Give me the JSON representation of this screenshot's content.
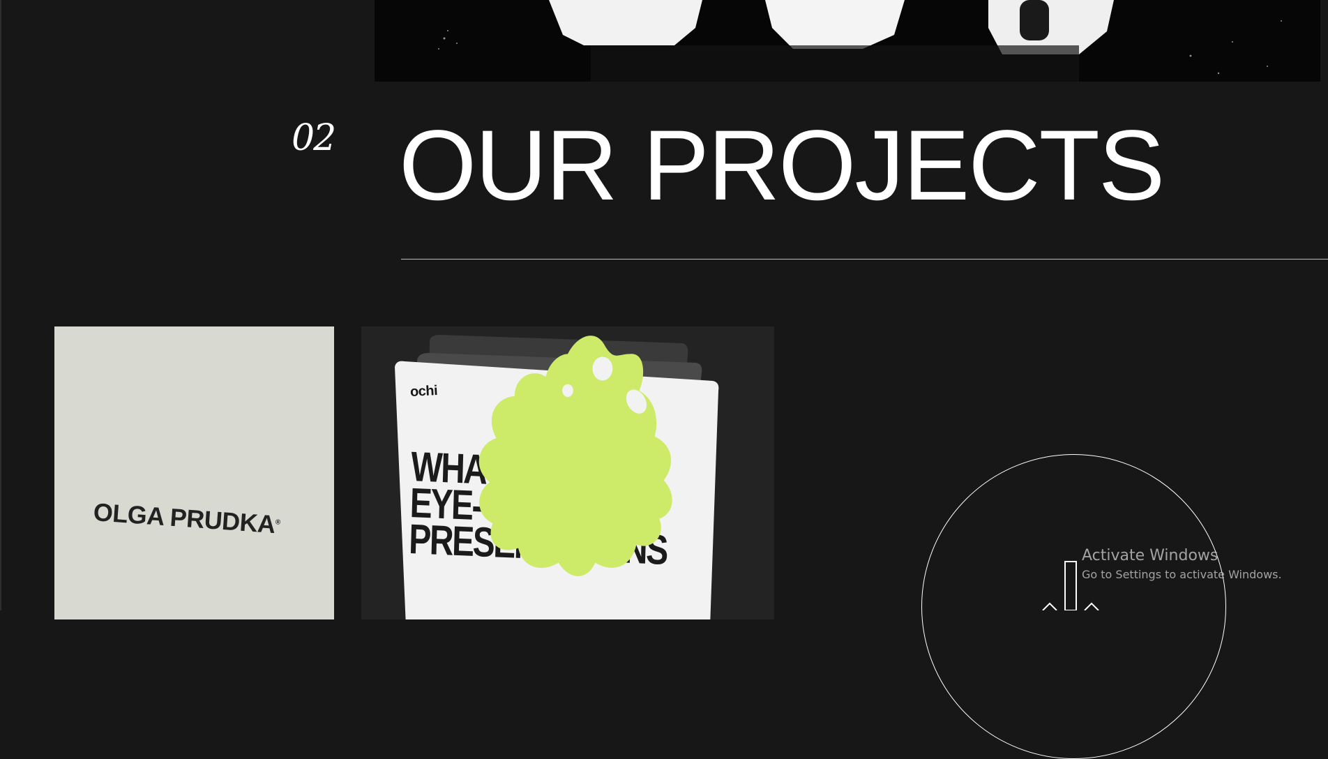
{
  "section": {
    "number": "02",
    "title": "OUR PROJECTS"
  },
  "projects": [
    {
      "logo_text": "OLGA PRUDKA"
    },
    {
      "brand": "ochi",
      "headline": [
        "WHAT'S",
        "EYE-CATCHING",
        "PRESENTATIONS"
      ],
      "accent_color": "#cdea68"
    }
  ],
  "cta": {
    "icon": "arrow-down-icon"
  },
  "watermark": {
    "title": "Activate Windows",
    "subtitle": "Go to Settings to activate Windows."
  },
  "colors": {
    "background": "#171717",
    "text": "#ffffff",
    "accent": "#cdea68",
    "card_light": "#d8d9d1"
  }
}
